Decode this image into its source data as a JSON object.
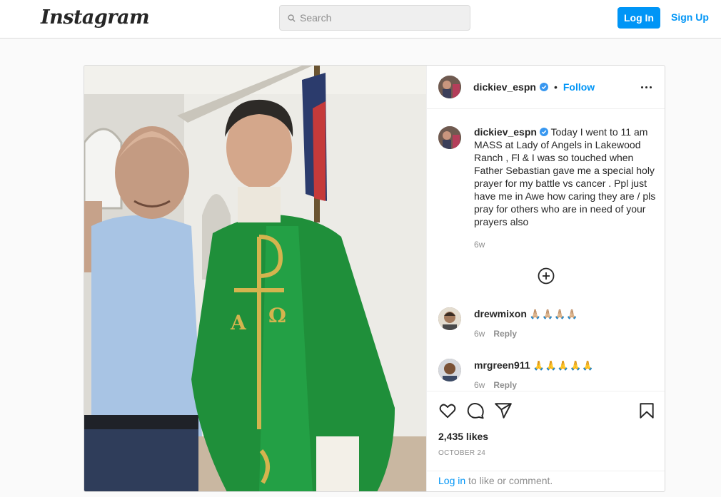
{
  "nav": {
    "logo": "Instagram",
    "search_placeholder": "Search",
    "login_label": "Log In",
    "signup_label": "Sign Up"
  },
  "post": {
    "author": "dickiev_espn",
    "follow_label": "Follow",
    "separator": "•",
    "caption": "Today I went to 11 am MASS at Lady of Angels in Lakewood Ranch , Fl & I was so touched when Father Sebastian gave me a special holy prayer for my battle vs cancer . Ppl just have me in Awe how caring they are / pls pray for others who are in need of your prayers also",
    "caption_age": "6w",
    "comments": [
      {
        "user": "drewmixon",
        "text": "🙏🏼🙏🏼🙏🏼🙏🏼",
        "age": "6w",
        "reply_label": "Reply"
      },
      {
        "user": "mrgreen911",
        "text": "🙏🙏🙏🙏🙏",
        "age": "6w",
        "reply_label": "Reply"
      }
    ],
    "likes": "2,435 likes",
    "date": "OCTOBER 24",
    "login_prompt": {
      "link": "Log in",
      "rest": " to like or comment."
    }
  },
  "colors": {
    "accent": "#0095f6",
    "border": "#dbdbdb",
    "muted": "#8e8e8e",
    "vestment": "#1f8f3a"
  },
  "icons": [
    "search-icon",
    "verified-icon",
    "more-icon",
    "load-more-icon",
    "heart-icon",
    "comment-icon",
    "share-icon",
    "bookmark-icon"
  ]
}
